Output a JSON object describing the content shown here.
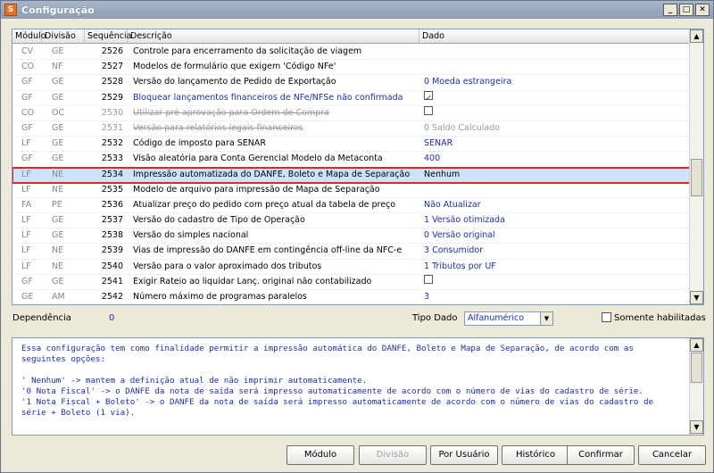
{
  "window": {
    "title": "Configuração",
    "app_icon_glyph": "S"
  },
  "grid": {
    "headers": {
      "modulo": "Módulo",
      "divisao": "Divisão",
      "sequencia": "Sequência",
      "descricao": "Descrição",
      "dado": "Dado"
    },
    "rows": [
      {
        "mod": "CV",
        "div": "GE",
        "seq": "2526",
        "desc": "Controle para encerramento da solicitação de viagem",
        "dado": "",
        "style": "normal"
      },
      {
        "mod": "CO",
        "div": "NF",
        "seq": "2527",
        "desc": "Modelos de formulário que exigem 'Código NFe'",
        "dado": "",
        "style": "normal"
      },
      {
        "mod": "GF",
        "div": "GE",
        "seq": "2528",
        "desc": "Versão do lançamento de Pedido de Exportação",
        "dado": "0 Moeda estrangeira",
        "style": "normal"
      },
      {
        "mod": "GF",
        "div": "GE",
        "seq": "2529",
        "desc": "Bloquear lançamentos financeiros de NFe/NFSe não confirmada",
        "dado": "",
        "checkbox": true,
        "checked": true,
        "style": "blue"
      },
      {
        "mod": "CO",
        "div": "OC",
        "seq": "2530",
        "desc": "Utilizar pré aprovação para Ordem de Compra",
        "dado": "",
        "checkbox": true,
        "checked": false,
        "style": "disabled"
      },
      {
        "mod": "GF",
        "div": "GE",
        "seq": "2531",
        "desc": "Versão para relatórios legais financeiros",
        "dado": "0 Saldo Calculado",
        "style": "disabled"
      },
      {
        "mod": "LF",
        "div": "GE",
        "seq": "2532",
        "desc": "Código de imposto para SENAR",
        "dado": "SENAR",
        "style": "normal"
      },
      {
        "mod": "GF",
        "div": "GE",
        "seq": "2533",
        "desc": "Visão aleatória para Conta Gerencial Modelo da Metaconta",
        "dado": "400",
        "style": "normal"
      },
      {
        "mod": "LF",
        "div": "NE",
        "seq": "2534",
        "desc": "Impressão automatizada do DANFE, Boleto e Mapa de Separação",
        "dado": "Nenhum",
        "style": "selected"
      },
      {
        "mod": "LF",
        "div": "NE",
        "seq": "2535",
        "desc": "Modelo de arquivo para impressão de Mapa de Separação",
        "dado": "",
        "style": "normal"
      },
      {
        "mod": "FA",
        "div": "PE",
        "seq": "2536",
        "desc": "Atualizar preço do pedido com preço atual da tabela de preço",
        "dado": "Não Atualizar",
        "style": "normal"
      },
      {
        "mod": "LF",
        "div": "GE",
        "seq": "2537",
        "desc": "Versão do cadastro de Tipo de Operação",
        "dado": "1 Versão otimizada",
        "style": "normal"
      },
      {
        "mod": "LF",
        "div": "GE",
        "seq": "2538",
        "desc": "Versão do simples nacional",
        "dado": "0 Versão original",
        "style": "normal"
      },
      {
        "mod": "LF",
        "div": "NE",
        "seq": "2539",
        "desc": "Vias de impressão do DANFE em contingência off-line da NFC-e",
        "dado": "3 Consumidor",
        "style": "normal"
      },
      {
        "mod": "LF",
        "div": "NE",
        "seq": "2540",
        "desc": "Versão para o valor aproximado dos tributos",
        "dado": "1 Tributos por UF",
        "style": "normal"
      },
      {
        "mod": "GF",
        "div": "GE",
        "seq": "2541",
        "desc": "Exigir Rateio ao liquidar Lanç. original não contabilizado",
        "dado": "",
        "checkbox": true,
        "checked": false,
        "style": "normal"
      },
      {
        "mod": "GE",
        "div": "AM",
        "seq": "2542",
        "desc": "Número máximo de programas paralelos",
        "dado": "3",
        "style": "normal"
      }
    ]
  },
  "footer": {
    "dependencia_label": "Dependência",
    "dependencia_value": "0",
    "tipo_dado_label": "Tipo Dado",
    "tipo_dado_value": "Alfanumérico",
    "somente_label": "Somente habilitadas"
  },
  "description": "Essa configuração tem como finalidade permitir a impressão automática do DANFE, Boleto e Mapa de Separação, de acordo com as seguintes opções:\n\n' Nenhum' -> mantem a definição atual de não imprimir automaticamente.\n'0 Nota Fiscal' -> o DANFE da nota de saída será impresso automaticamente de acordo com o número de vias do cadastro de série.\n'1 Nota Fiscal + Boleto' -> o DANFE da nota de saída será impresso automaticamente de acordo com o número de vias do cadastro de série + Boleto (1 via).",
  "buttons": {
    "modulo": "Módulo",
    "divisao": "Divisão",
    "por_usuario": "Por Usuário",
    "historico": "Histórico",
    "confirmar": "Confirmar",
    "cancelar": "Cancelar"
  },
  "glyphs": {
    "minimize": "_",
    "maximize": "□",
    "close": "✕",
    "up": "▲",
    "down": "▼",
    "check": "✓"
  },
  "colors": {
    "accent_text": "#1c2fa8",
    "selection_border": "#e5242a",
    "selection_bg": "#c9e4fb"
  }
}
